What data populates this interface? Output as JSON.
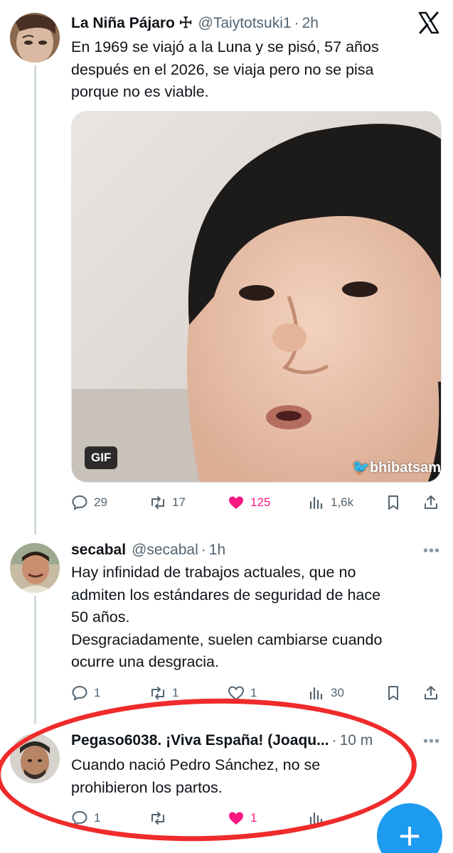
{
  "tweets": [
    {
      "name": "La Niña Pájaro ☩",
      "handle": "@Taiytotsuki1",
      "time": "2h",
      "text": [
        "En 1969 se viajó a la Luna y se pisó, 57 años",
        "después en el 2026, se viaja pero no se pisa",
        "porque no es viable."
      ],
      "media": {
        "badge": "GIF",
        "watermark": "bhibatsam"
      },
      "stats": {
        "replies": "29",
        "retweets": "17",
        "likes": "125",
        "views": "1,6k"
      }
    },
    {
      "name": "secabal",
      "handle": "@secabal",
      "time": "1h",
      "text": [
        "Hay infinidad de trabajos actuales, que no",
        "admiten los estándares de seguridad de hace",
        "50 años.",
        "Desgraciadamente, suelen cambiarse cuando",
        "ocurre una desgracia."
      ],
      "stats": {
        "replies": "1",
        "retweets": "1",
        "likes": "1",
        "views": "30"
      }
    },
    {
      "name": "Pegaso6038. ¡Viva España! (Joaqu...",
      "time": "10 m",
      "text": [
        "Cuando nació Pedro Sánchez, no se",
        "prohibieron los partos."
      ],
      "stats": {
        "replies": "1",
        "likes": "1"
      }
    }
  ],
  "icons": {
    "close": "x-logo-icon",
    "reply": "reply-icon",
    "retweet": "retweet-icon",
    "like": "heart-icon",
    "views": "views-icon",
    "bookmark": "bookmark-icon",
    "share": "share-icon",
    "more": "more-icon",
    "compose": "plus-icon"
  },
  "more_label": "•••",
  "fab_label": "+",
  "colors": {
    "accent": "#1d9bf0",
    "like": "#f91880",
    "annotation": "#ef2b2b",
    "muted": "#536471"
  }
}
